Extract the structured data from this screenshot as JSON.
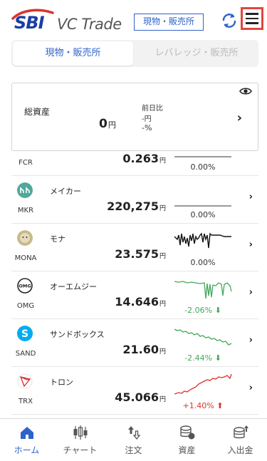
{
  "header": {
    "logo_brand": "SBI",
    "logo_text": "VC Trade",
    "badge": "現物・販売所"
  },
  "tabs": [
    {
      "label": "現物・販売所",
      "active": true
    },
    {
      "label": "レバレッジ・販売所",
      "active": false
    }
  ],
  "asset_card": {
    "label": "総資産",
    "value": "0",
    "unit": "円",
    "prev_label": "前日比",
    "prev_yen": "-円",
    "prev_pct": "-%"
  },
  "coins": [
    {
      "ticker": "FCR",
      "name": "",
      "price": "0.263",
      "unit": "円",
      "change": "0.00%",
      "trend": "flat",
      "icon_color": "#999999"
    },
    {
      "ticker": "MKR",
      "name": "メイカー",
      "price": "220,275",
      "unit": "円",
      "change": "0.00%",
      "trend": "flat",
      "icon_color": "#4fa89b"
    },
    {
      "ticker": "MONA",
      "name": "モナ",
      "price": "23.575",
      "unit": "円",
      "change": "0.00%",
      "trend": "flat",
      "icon_color": "#c8b98a"
    },
    {
      "ticker": "OMG",
      "name": "オーエムジー",
      "price": "14.646",
      "unit": "円",
      "change": "-2.06%",
      "trend": "down",
      "icon_color": "#222222"
    },
    {
      "ticker": "SAND",
      "name": "サンドボックス",
      "price": "21.60",
      "unit": "円",
      "change": "-2.44%",
      "trend": "down",
      "icon_color": "#00adef"
    },
    {
      "ticker": "TRX",
      "name": "トロン",
      "price": "45.066",
      "unit": "円",
      "change": "+1.40%",
      "trend": "up",
      "icon_color": "#d62b2b"
    }
  ],
  "colors": {
    "accent": "#2f63c9",
    "down": "#43a85a",
    "up": "#d9332b",
    "menu_highlight": "#e2463b"
  },
  "bottom_nav": [
    {
      "label": "ホーム",
      "icon": "home-icon",
      "active": true
    },
    {
      "label": "チャート",
      "icon": "candlestick-icon",
      "active": false
    },
    {
      "label": "注文",
      "icon": "order-icon",
      "active": false
    },
    {
      "label": "資産",
      "icon": "coins-icon",
      "active": false
    },
    {
      "label": "入出金",
      "icon": "deposit-icon",
      "active": false
    }
  ]
}
